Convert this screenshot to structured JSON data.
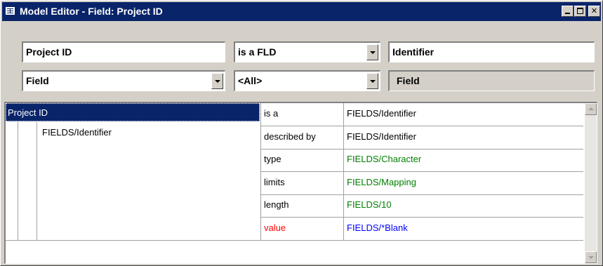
{
  "window": {
    "title": "Model Editor - Field: Project ID"
  },
  "header": {
    "name_value": "Project ID",
    "relation_value": "is a FLD",
    "type_value": "Identifier",
    "category_value": "Field",
    "filter_value": "<All>",
    "kind_label": "Field"
  },
  "tree": {
    "root": "Project ID",
    "child": "FIELDS/Identifier"
  },
  "properties": [
    {
      "name": "is a",
      "value": "FIELDS/Identifier",
      "name_color": "#000000",
      "value_color": "#000000"
    },
    {
      "name": "described by",
      "value": "FIELDS/Identifier",
      "name_color": "#000000",
      "value_color": "#000000"
    },
    {
      "name": "type",
      "value": "FIELDS/Character",
      "name_color": "#000000",
      "value_color": "#008000"
    },
    {
      "name": "limits",
      "value": "FIELDS/Mapping",
      "name_color": "#000000",
      "value_color": "#008000"
    },
    {
      "name": "length",
      "value": "FIELDS/10",
      "name_color": "#000000",
      "value_color": "#008000"
    },
    {
      "name": "value",
      "value": "FIELDS/*Blank",
      "name_color": "#ff0000",
      "value_color": "#0000ff"
    }
  ],
  "colors": {
    "titlebar": "#0a246a",
    "selection": "#0a246a",
    "face": "#d4d0c8"
  },
  "icons": [
    "grid-icon",
    "minimize-icon",
    "maximize-icon",
    "close-icon",
    "dropdown-arrow-icon",
    "scroll-up-icon",
    "scroll-down-icon"
  ]
}
